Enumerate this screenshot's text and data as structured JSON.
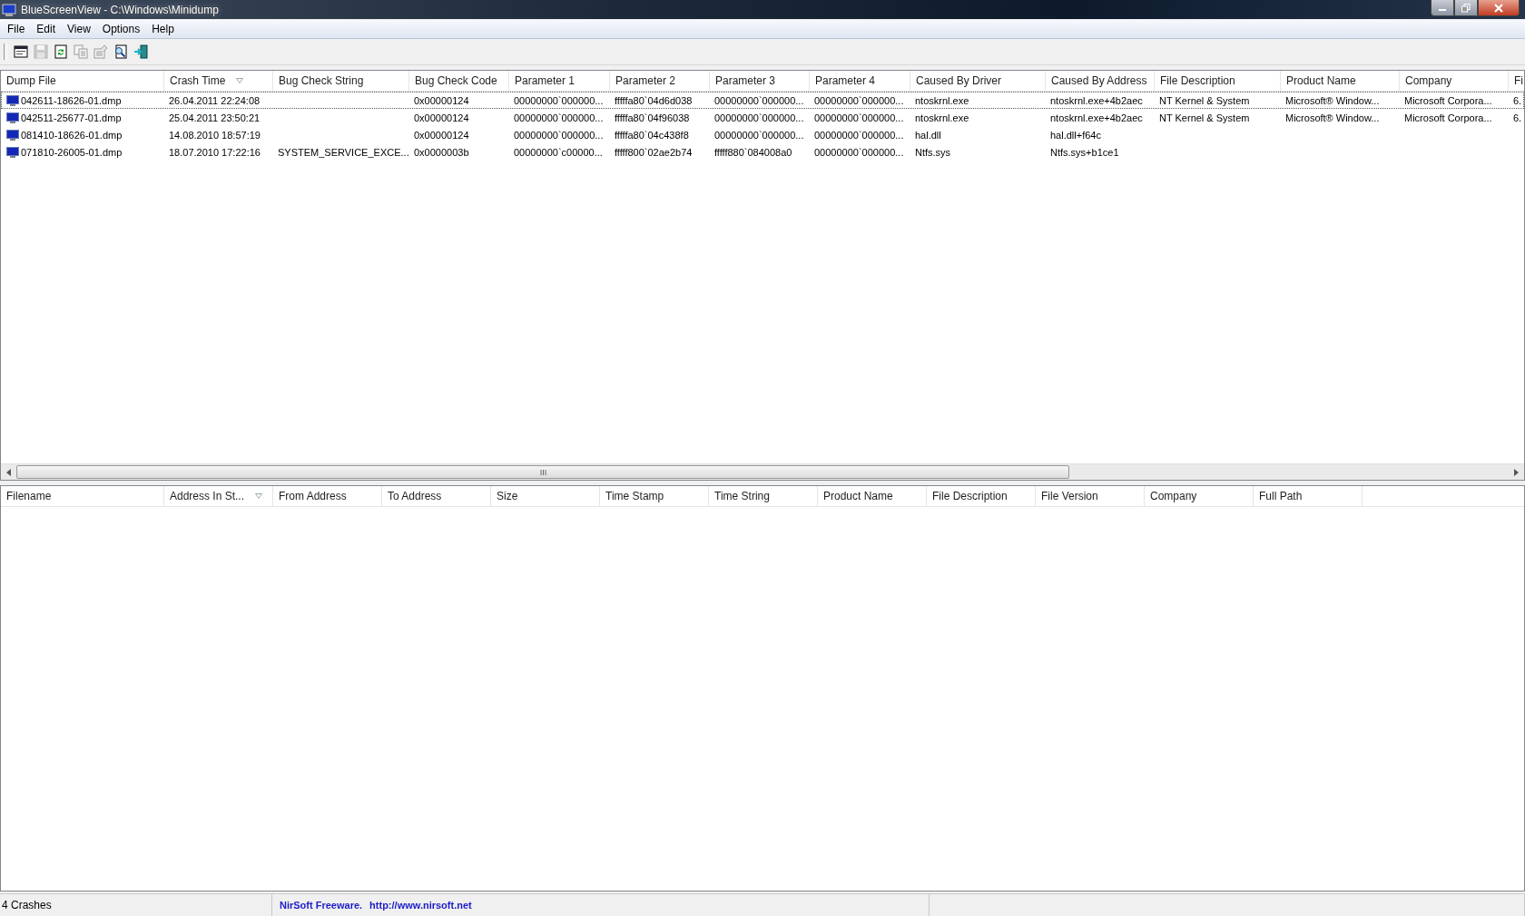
{
  "window": {
    "title": "BlueScreenView  -  C:\\Windows\\Minidump"
  },
  "menu": [
    "File",
    "Edit",
    "View",
    "Options",
    "Help"
  ],
  "toolbar": [
    {
      "kind": "options",
      "disabled": false
    },
    {
      "kind": "save",
      "disabled": true
    },
    {
      "kind": "refresh",
      "disabled": false
    },
    {
      "kind": "copy",
      "disabled": true
    },
    {
      "kind": "properties",
      "disabled": true
    },
    {
      "kind": "find",
      "disabled": false
    },
    {
      "kind": "exit",
      "disabled": false
    }
  ],
  "crash_table": {
    "columns": [
      {
        "label": "Dump File"
      },
      {
        "label": "Crash Time",
        "sorted": true
      },
      {
        "label": "Bug Check String"
      },
      {
        "label": "Bug Check Code"
      },
      {
        "label": "Parameter 1"
      },
      {
        "label": "Parameter 2"
      },
      {
        "label": "Parameter 3"
      },
      {
        "label": "Parameter 4"
      },
      {
        "label": "Caused By Driver"
      },
      {
        "label": "Caused By Address"
      },
      {
        "label": "File Description"
      },
      {
        "label": "Product Name"
      },
      {
        "label": "Company"
      },
      {
        "label": "Fi"
      }
    ],
    "rows": [
      {
        "focused": true,
        "cells": [
          "042611-18626-01.dmp",
          "26.04.2011 22:24:08",
          null,
          "0x00000124",
          "00000000`000000...",
          "fffffa80`04d6d038",
          "00000000`000000...",
          "00000000`000000...",
          "ntoskrnl.exe",
          "ntoskrnl.exe+4b2aec",
          "NT Kernel & System",
          "Microsoft® Window...",
          "Microsoft Corpora...",
          "6."
        ]
      },
      {
        "focused": false,
        "cells": [
          "042511-25677-01.dmp",
          "25.04.2011 23:50:21",
          null,
          "0x00000124",
          "00000000`000000...",
          "fffffa80`04f96038",
          "00000000`000000...",
          "00000000`000000...",
          "ntoskrnl.exe",
          "ntoskrnl.exe+4b2aec",
          "NT Kernel & System",
          "Microsoft® Window...",
          "Microsoft Corpora...",
          "6."
        ]
      },
      {
        "focused": false,
        "cells": [
          "081410-18626-01.dmp",
          "14.08.2010 18:57:19",
          null,
          "0x00000124",
          "00000000`000000...",
          "fffffa80`04c438f8",
          "00000000`000000...",
          "00000000`000000...",
          "hal.dll",
          "hal.dll+f64c",
          null,
          null,
          null,
          null
        ]
      },
      {
        "focused": false,
        "cells": [
          "071810-26005-01.dmp",
          "18.07.2010 17:22:16",
          "SYSTEM_SERVICE_EXCE...",
          "0x0000003b",
          "00000000`c00000...",
          "fffff800`02ae2b74",
          "fffff880`084008a0",
          "00000000`000000...",
          "Ntfs.sys",
          "Ntfs.sys+b1ce1",
          null,
          null,
          null,
          null
        ]
      }
    ]
  },
  "driver_table": {
    "columns": [
      {
        "label": "Filename"
      },
      {
        "label": "Address In St...",
        "sorted": true
      },
      {
        "label": "From Address"
      },
      {
        "label": "To Address"
      },
      {
        "label": "Size"
      },
      {
        "label": "Time Stamp"
      },
      {
        "label": "Time String"
      },
      {
        "label": "Product Name"
      },
      {
        "label": "File Description"
      },
      {
        "label": "File Version"
      },
      {
        "label": "Company"
      },
      {
        "label": "Full Path"
      }
    ]
  },
  "status_bar": {
    "count": "4 Crashes",
    "credit": "NirSoft Freeware.",
    "link": "http://www.nirsoft.net"
  }
}
